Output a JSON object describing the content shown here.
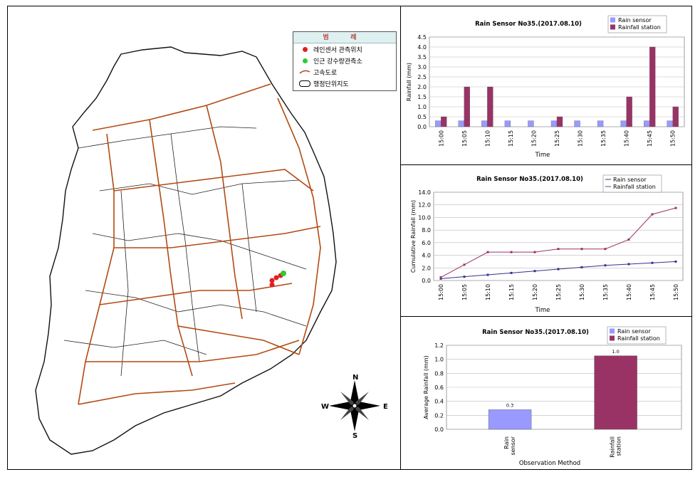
{
  "map": {
    "legend": {
      "header": "범 례",
      "items": [
        {
          "label": "레인센서 관측위치",
          "color": "#e02020"
        },
        {
          "label": "인근 강수량관측소",
          "color": "#2ecc2e"
        },
        {
          "label": "고속도로",
          "color": "#b24a12"
        },
        {
          "label": "행정단위지도",
          "color": "#000000"
        }
      ]
    },
    "compass": {
      "n": "N",
      "s": "S",
      "e": "E",
      "w": "W"
    }
  },
  "chart_data": [
    {
      "type": "bar",
      "title": "Rain Sensor No35.(2017.08.10)",
      "xlabel": "Time",
      "ylabel": "Rainfall (mm)",
      "ylim": [
        0,
        4.5
      ],
      "yticks": [
        "0.0",
        "0.5",
        "1.0",
        "1.5",
        "2.0",
        "2.5",
        "3.0",
        "3.5",
        "4.0",
        "4.5"
      ],
      "categories": [
        "15:00",
        "15:05",
        "15:10",
        "15:15",
        "15:20",
        "15:25",
        "15:30",
        "15:35",
        "15:40",
        "15:45",
        "15:50"
      ],
      "series": [
        {
          "name": "Rain sensor",
          "color": "#9999ff",
          "values": [
            0.3,
            0.3,
            0.3,
            0.3,
            0.3,
            0.3,
            0.3,
            0.3,
            0.3,
            0.3,
            0.3
          ]
        },
        {
          "name": "Rainfall station",
          "color": "#993366",
          "values": [
            0.5,
            2.0,
            2.0,
            0,
            0,
            0.5,
            0,
            0,
            1.5,
            4.0,
            1.0
          ]
        }
      ],
      "legend": "top-right",
      "grid": true
    },
    {
      "type": "line",
      "title": "Rain Sensor No35.(2017.08.10)",
      "xlabel": "Time",
      "ylabel": "Cumulative Rainfall (mm)",
      "ylim": [
        0,
        14
      ],
      "yticks": [
        "0.0",
        "2.0",
        "4.0",
        "6.0",
        "8.0",
        "10.0",
        "12.0",
        "14.0"
      ],
      "categories": [
        "15:00",
        "15:05",
        "15:10",
        "15:15",
        "15:20",
        "15:25",
        "15:30",
        "15:35",
        "15:40",
        "15:45",
        "15:50"
      ],
      "series": [
        {
          "name": "Rain sensor",
          "color": "#33338a",
          "values": [
            0.3,
            0.6,
            0.9,
            1.2,
            1.5,
            1.8,
            2.1,
            2.4,
            2.6,
            2.8,
            3.0
          ]
        },
        {
          "name": "Rainfall station",
          "color": "#993366",
          "values": [
            0.5,
            2.5,
            4.5,
            4.5,
            4.5,
            5.0,
            5.0,
            5.0,
            6.5,
            10.5,
            11.5
          ]
        }
      ],
      "legend": "top-right",
      "grid": true
    },
    {
      "type": "bar",
      "title": "Rain Sensor No35.(2017.08.10)",
      "xlabel": "Observation Method",
      "ylabel": "Average Rainfall (mm)",
      "ylim": [
        0,
        1.2
      ],
      "yticks": [
        "0.0",
        "0.2",
        "0.4",
        "0.6",
        "0.8",
        "1.0",
        "1.2"
      ],
      "categories": [
        "Rain sensor",
        "Rainfall station"
      ],
      "values": [
        0.28,
        1.05
      ],
      "data_labels": [
        "0.3",
        "1.0"
      ],
      "colors": [
        "#9999ff",
        "#993366"
      ],
      "series_names": [
        "Rain sensor",
        "Rainfall station"
      ],
      "legend": "top-right",
      "grid": true
    }
  ]
}
